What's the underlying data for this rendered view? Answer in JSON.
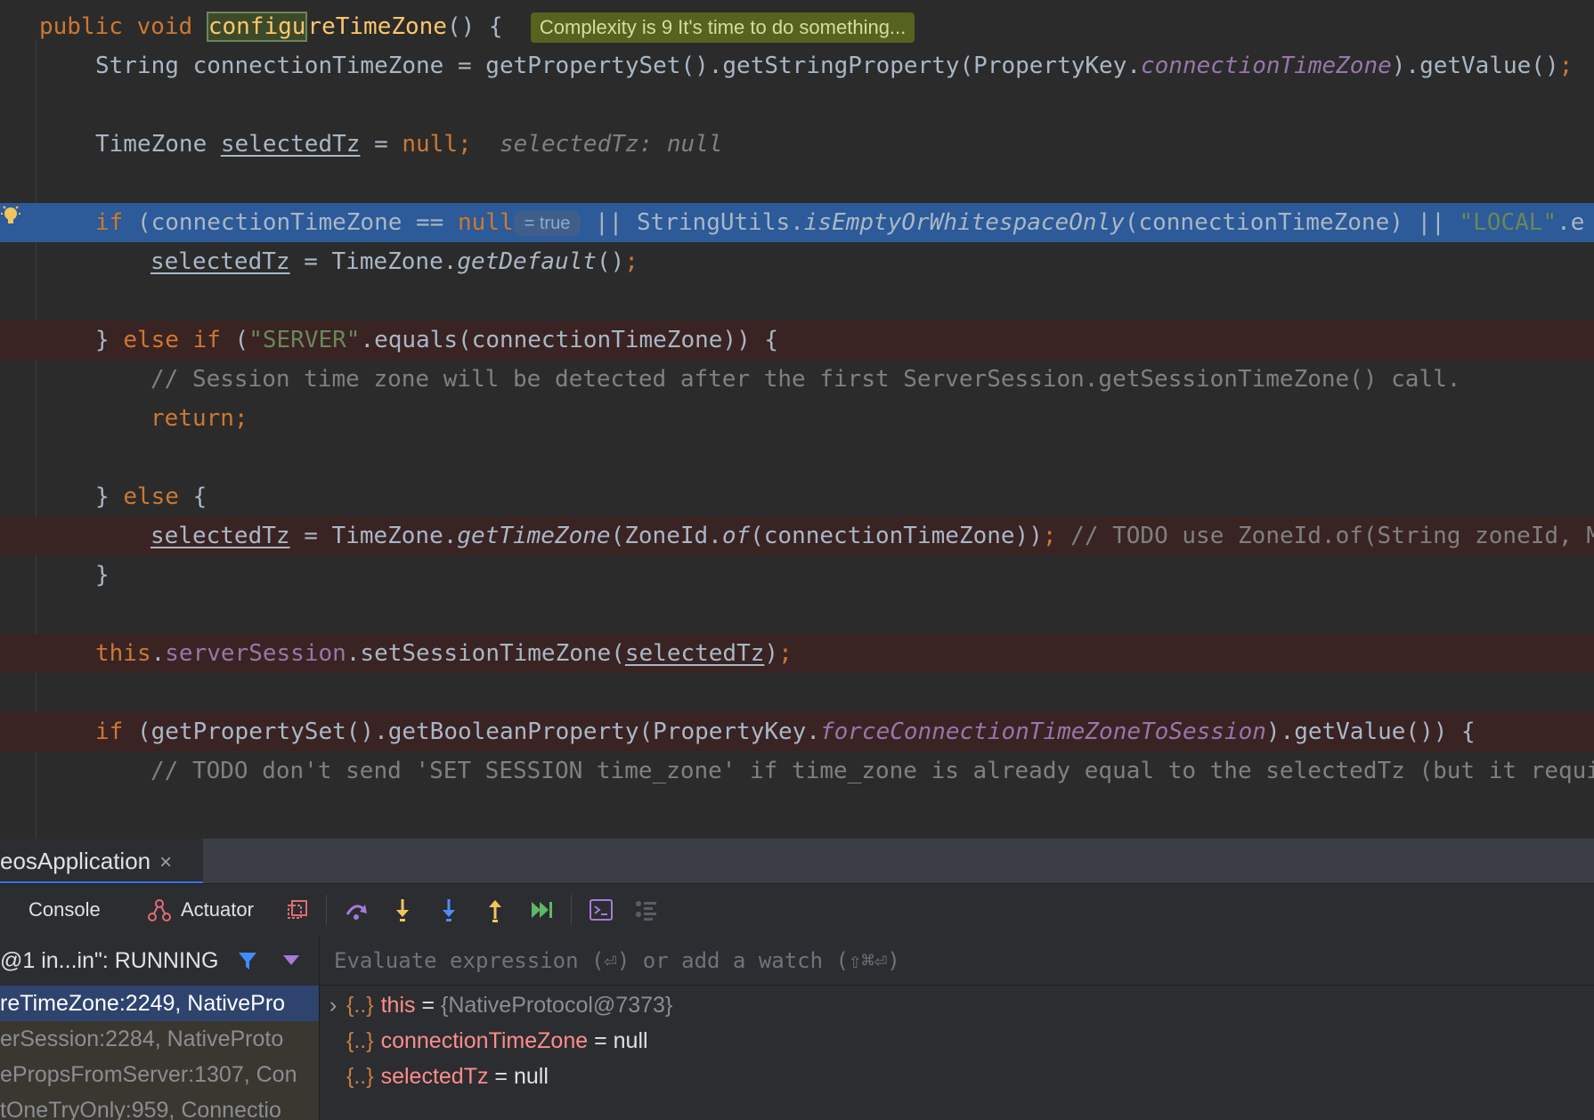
{
  "editor": {
    "method_signature": {
      "kw": "public void ",
      "name_hl": "configu",
      "name_rest": "reTimeZone",
      "tail": "() {"
    },
    "complexity_hint": "Complexity is 9 It's time to do something...",
    "l2": {
      "a": "String connectionTimeZone = getPropertySet().getStringProperty(PropertyKey.",
      "b": "connectionTimeZone",
      "c": ").getValue()",
      "d": ";"
    },
    "l4": {
      "a": "TimeZone ",
      "b": "selectedTz",
      "c": " = ",
      "d": "null",
      "e": ";",
      "inline": "selectedTz: null"
    },
    "l6": {
      "a": "if",
      "b": " (connectionTimeZone == ",
      "c": "null",
      "hint": "= true",
      "d": " || StringUtils.",
      "e": "isEmptyOrWhitespaceOnly",
      "f": "(connectionTimeZone) || ",
      "g": "\"LOCAL\"",
      "h": ".e"
    },
    "l7": {
      "a": "selectedTz",
      "b": " = TimeZone.",
      "c": "getDefault",
      "d": "()",
      "e": ";"
    },
    "l9": {
      "a": "} ",
      "b": "else if",
      "c": " (",
      "d": "\"SERVER\"",
      "e": ".equals(connectionTimeZone)) {"
    },
    "l10": {
      "a": "// Session time zone will be detected after the first ServerSession.getSessionTimeZone() call."
    },
    "l11": {
      "a": "return;"
    },
    "l13": {
      "a": "} ",
      "b": "else",
      "c": " {"
    },
    "l14": {
      "a": "selectedTz",
      "b": " = TimeZone.",
      "c": "getTimeZone",
      "d": "(ZoneId.",
      "e": "of",
      "f": "(connectionTimeZone))",
      "g": ";",
      "h": " // TODO use ZoneId.of(String zoneId, M"
    },
    "l15": {
      "a": "}"
    },
    "l17": {
      "a": "this",
      "b": ".",
      "c": "serverSession",
      "d": ".setSessionTimeZone(",
      "e": "selectedTz",
      "f": ")",
      "g": ";"
    },
    "l19": {
      "a": "if",
      "b": " (getPropertySet().getBooleanProperty(PropertyKey.",
      "c": "forceConnectionTimeZoneToSession",
      "d": ").getValue()) {"
    },
    "l20": {
      "a": "// TODO don't send 'SET SESSION time_zone' if time_zone is already equal to the selectedTz (but it requi"
    }
  },
  "debug": {
    "tab_label": "eosApplication",
    "tab_close": "×",
    "toolbar": {
      "console": "Console",
      "actuator": "Actuator"
    },
    "thread": "@1 in...in\": RUNNING",
    "frames": [
      "reTimeZone:2249, NativePro",
      "erSession:2284, NativeProto",
      "ePropsFromServer:1307, Con",
      "tOneTryOnly:959, Connectio"
    ],
    "eval_placeholder": "Evaluate expression (⏎) or add a watch (⇧⌘⏎)",
    "variables": [
      {
        "expandable": true,
        "name": "this",
        "eq": " = ",
        "value": "{NativeProtocol@7373}"
      },
      {
        "expandable": false,
        "name": "connectionTimeZone",
        "eq": " = ",
        "value": "null"
      },
      {
        "expandable": false,
        "name": "selectedTz",
        "eq": " = ",
        "value": "null"
      }
    ]
  },
  "icons": [
    "lightbulb-icon",
    "close-icon",
    "actuator-icon",
    "stop-frame-icon",
    "step-over-icon",
    "step-into-icon",
    "force-step-into-icon",
    "step-out-icon",
    "run-to-cursor-icon",
    "evaluate-icon",
    "watches-icon",
    "filter-icon",
    "dropdown-arrow-icon",
    "expand-arrow-icon"
  ],
  "colors": {
    "editor_bg": "#2b2b2b",
    "keyword": "#cc7832",
    "string": "#6a8759",
    "field": "#9876aa",
    "exec_line": "#2d5a98",
    "breakpoint_line": "#3a2323",
    "complexity_hint_bg": "#56631e"
  }
}
